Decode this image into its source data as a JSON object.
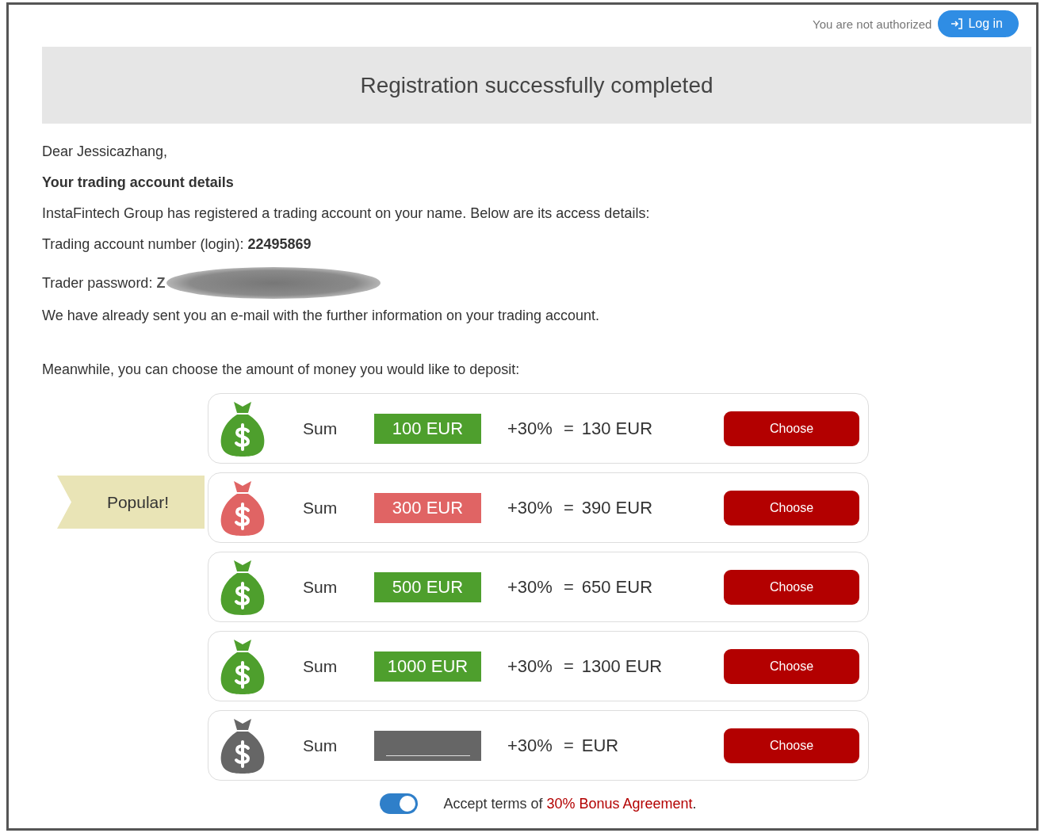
{
  "auth": {
    "status": "You are not authorized",
    "login_button": "Log in"
  },
  "header": {
    "title": "Registration successfully completed"
  },
  "greeting": "Dear Jessicazhang,",
  "details_heading": "Your trading account details",
  "intro": "InstaFintech Group has registered a trading account on your name. Below are its access details:",
  "account_number": "Trading account number (login): **22495869**",
  "password": {
    "label": "Trader password:",
    "visible_part": "Z",
    "redacted": true
  },
  "email_note": "We have already sent you an e-mail with the further information on your trading account.",
  "deposit_prompt": "Meanwhile, you can choose the amount of money you would like to deposit:",
  "deposits": [
    {
      "kind": "fixed",
      "color": "#4e9f2d",
      "sum_label": "Sum",
      "amount": "100 EUR",
      "bonus": "+30%",
      "equals": "=",
      "total": "130 EUR",
      "button": "Choose"
    },
    {
      "kind": "fixed",
      "color": "#e06464",
      "badge": "Popular!",
      "sum_label": "Sum",
      "amount": "300 EUR",
      "bonus": "+30%",
      "equals": "=",
      "total": "390 EUR",
      "button": "Choose"
    },
    {
      "kind": "fixed",
      "color": "#4e9f2d",
      "sum_label": "Sum",
      "amount": "500 EUR",
      "bonus": "+30%",
      "equals": "=",
      "total": "650 EUR",
      "button": "Choose"
    },
    {
      "kind": "fixed",
      "color": "#4e9f2d",
      "sum_label": "Sum",
      "amount": "1000 EUR",
      "bonus": "+30%",
      "equals": "=",
      "total": "1300 EUR",
      "button": "Choose"
    },
    {
      "kind": "custom",
      "color": "#666666",
      "sum_label": "Sum",
      "bonus": "+30%",
      "equals": "=",
      "total": "EUR",
      "button": "Choose"
    }
  ],
  "terms": {
    "on": true,
    "text": "Accept terms of ",
    "link": "30% Bonus Agreement",
    "end": "."
  }
}
